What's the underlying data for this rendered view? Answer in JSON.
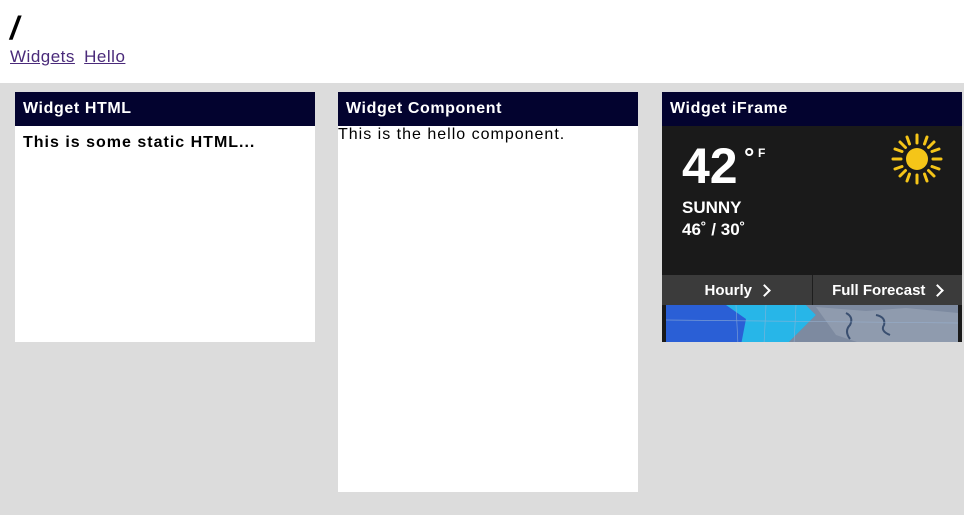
{
  "header": {
    "title": "/",
    "links": [
      "Widgets",
      "Hello"
    ]
  },
  "widgets": {
    "html": {
      "title": "Widget HTML",
      "content": "This is some static HTML..."
    },
    "component": {
      "title": "Widget Component",
      "content": "This is the hello component."
    },
    "iframe": {
      "title": "Widget iFrame",
      "weather": {
        "temperature": "42",
        "degree_symbol": "°",
        "unit": "F",
        "condition": "SUNNY",
        "high_low": "46˚ / 30˚",
        "hourly_label": "Hourly",
        "forecast_label": "Full Forecast",
        "icon": "sun-icon"
      }
    }
  },
  "colors": {
    "header_bg": "#03032f",
    "content_bg": "#dcdcdc",
    "link": "#4a2a7a",
    "weather_bg": "#1a1a1a",
    "weather_bar": "#3b3b3b",
    "sun": "#f5c518"
  }
}
